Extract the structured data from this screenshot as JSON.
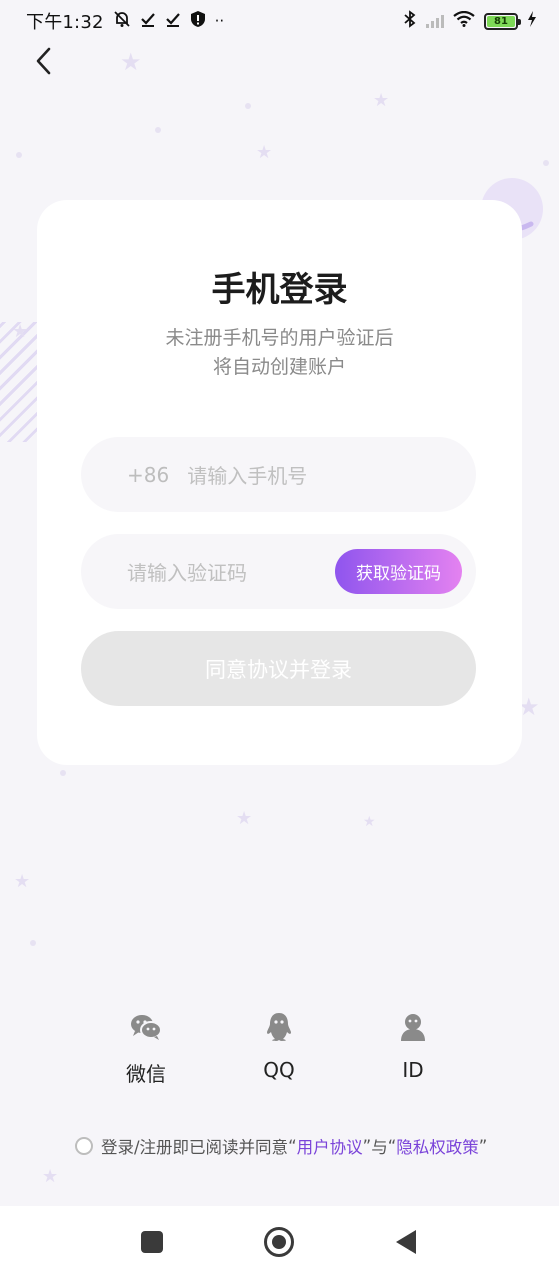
{
  "status_bar": {
    "time": "下午1:32",
    "battery_level": "81",
    "icons": [
      "bell-muted-icon",
      "check-icon",
      "check-icon",
      "shield-alert-icon",
      "more-icon",
      "bluetooth-icon",
      "signal-icon",
      "wifi-icon",
      "battery-icon",
      "charging-icon"
    ],
    "battery_color": "#7ed957"
  },
  "header": {
    "back_icon": "chevron-left-icon"
  },
  "login_card": {
    "title": "手机登录",
    "subtitle_line1": "未注册手机号的用户验证后",
    "subtitle_line2": "将自动创建账户",
    "phone": {
      "prefix": "+86",
      "placeholder": "请输入手机号",
      "value": ""
    },
    "code": {
      "placeholder": "请输入验证码",
      "value": "",
      "get_code_label": "获取验证码"
    },
    "submit_label": "同意协议并登录"
  },
  "social_login": [
    {
      "icon": "wechat-icon",
      "label": "微信"
    },
    {
      "icon": "qq-icon",
      "label": "QQ"
    },
    {
      "icon": "user-icon",
      "label": "ID"
    }
  ],
  "agreement": {
    "text_before": "登录/注册即已阅读并同意",
    "quote_open1": "“",
    "user_agreement": "用户协议",
    "quote_close1": "”",
    "and": "与",
    "quote_open2": "“",
    "privacy_policy": "隐私权政策",
    "quote_close2": "”",
    "checked": false
  },
  "nav_bar": {
    "buttons": [
      "recent-apps-icon",
      "home-icon",
      "back-icon"
    ]
  },
  "colors": {
    "accent_gradient_start": "#8f55ee",
    "accent_gradient_end": "#e482f0",
    "link": "#7a43d9",
    "background": "#f6f5f9",
    "disabled_button": "#e6e6e6"
  }
}
